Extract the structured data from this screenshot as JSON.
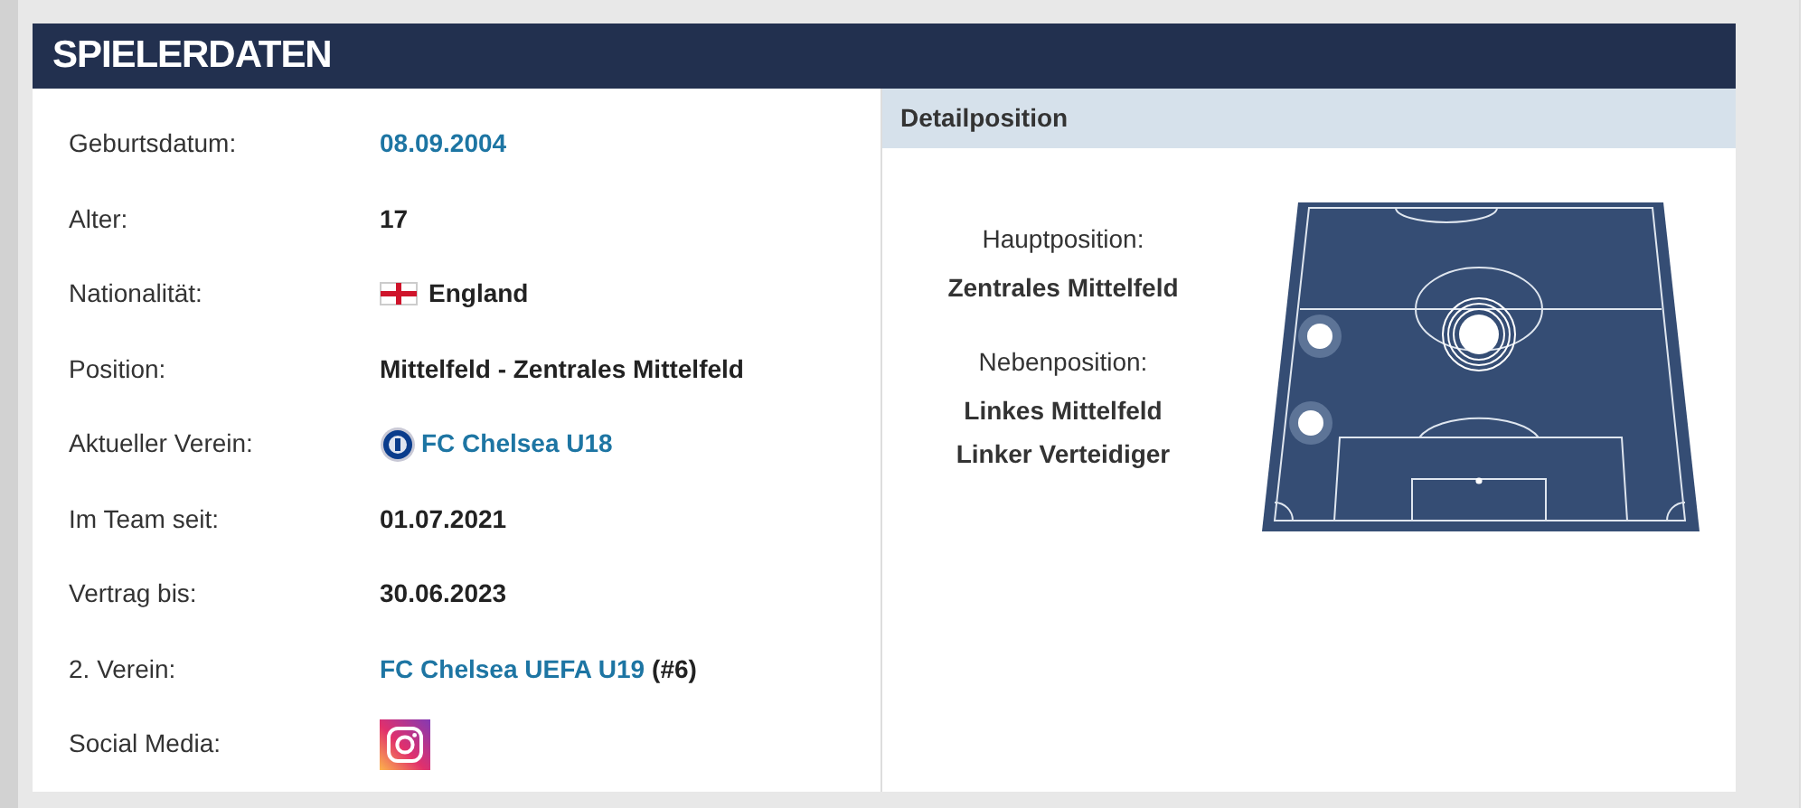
{
  "section_title": "SPIELERDATEN",
  "rows": [
    {
      "label": "Geburtsdatum:",
      "kind": "link",
      "value": "08.09.2004"
    },
    {
      "label": "Alter:",
      "kind": "text",
      "value": "17"
    },
    {
      "label": "Nationalität:",
      "kind": "flag",
      "value": "England"
    },
    {
      "label": "Position:",
      "kind": "text",
      "value": "Mittelfeld - Zentrales Mittelfeld"
    },
    {
      "label": "Aktueller Verein:",
      "kind": "club",
      "value": "FC Chelsea U18"
    },
    {
      "label": "Im Team seit:",
      "kind": "text",
      "value": "01.07.2021"
    },
    {
      "label": "Vertrag bis:",
      "kind": "text",
      "value": "30.06.2023"
    },
    {
      "label": "2. Verein:",
      "kind": "link",
      "value": "FC Chelsea UEFA U19",
      "suffix": "(#6)"
    },
    {
      "label": "Social Media:",
      "kind": "instagram"
    }
  ],
  "detail": {
    "title": "Detailposition",
    "main_label": "Hauptposition:",
    "main": "Zentrales Mittelfeld",
    "side_label": "Nebenposition:",
    "side": [
      "Linkes Mittelfeld",
      "Linker Verteidiger"
    ]
  }
}
